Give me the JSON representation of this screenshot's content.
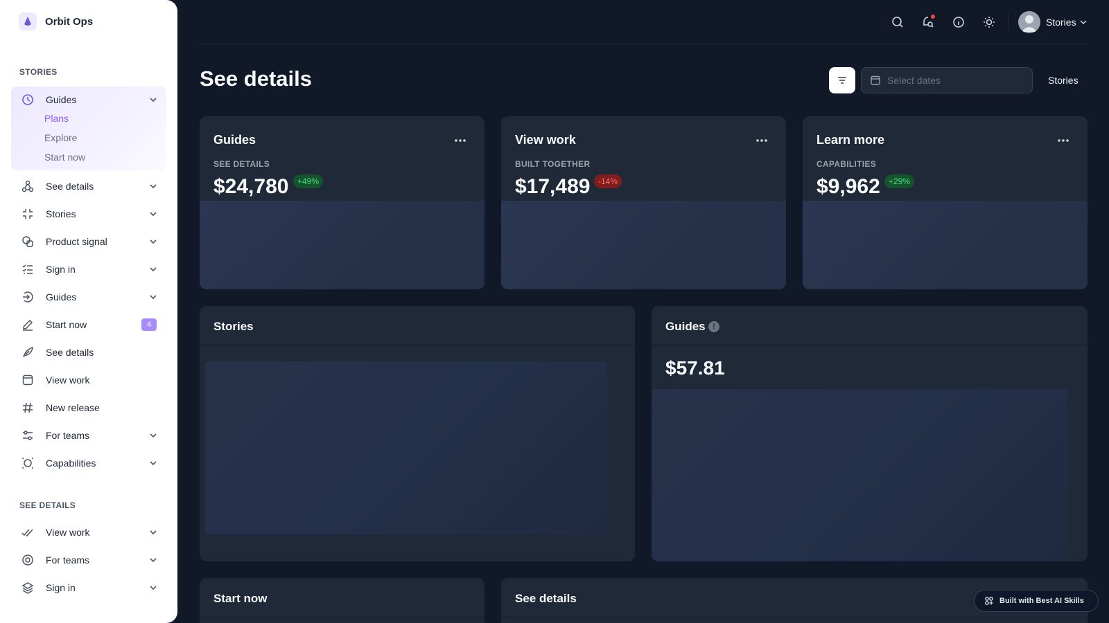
{
  "brand": {
    "name": "Orbit Ops",
    "icon": "drop-logo-icon"
  },
  "sidebar": {
    "section1_title": "STORIES",
    "section2_title": "SEE DETAILS",
    "open_group": {
      "label": "Guides",
      "icon": "clock-icon",
      "children": [
        "Plans",
        "Explore",
        "Start now"
      ],
      "active_child": "Plans"
    },
    "items": [
      {
        "label": "See details",
        "icon": "share-nodes-icon",
        "has_chevron": true
      },
      {
        "label": "Stories",
        "icon": "minimize-icon",
        "has_chevron": true
      },
      {
        "label": "Product signal",
        "icon": "shapes-icon",
        "has_chevron": true
      },
      {
        "label": "Sign in",
        "icon": "checklist-icon",
        "has_chevron": true
      },
      {
        "label": "Guides",
        "icon": "circle-arrow-icon",
        "has_chevron": true
      },
      {
        "label": "Start now",
        "icon": "pencil-icon",
        "badge": "4"
      },
      {
        "label": "See details",
        "icon": "feather-icon"
      },
      {
        "label": "View work",
        "icon": "square-icon"
      },
      {
        "label": "New release",
        "icon": "hash-icon"
      },
      {
        "label": "For teams",
        "icon": "sliders-icon",
        "has_chevron": true
      },
      {
        "label": "Capabilities",
        "icon": "focus-icon",
        "has_chevron": true
      }
    ],
    "items2": [
      {
        "label": "View work",
        "icon": "double-check-icon",
        "has_chevron": true
      },
      {
        "label": "For teams",
        "icon": "target-icon",
        "has_chevron": true
      },
      {
        "label": "Sign in",
        "icon": "layers-icon",
        "has_chevron": true
      }
    ]
  },
  "topbar": {
    "icons": [
      "search-icon",
      "notification-search-icon",
      "info-icon",
      "sun-icon"
    ],
    "user_name": "Stories"
  },
  "page": {
    "title": "See details",
    "date_placeholder": "Select dates",
    "header_link": "Stories"
  },
  "stat_cards": [
    {
      "title": "Guides",
      "subtitle": "SEE DETAILS",
      "value": "$24,780",
      "delta": "+49%",
      "trend": "up"
    },
    {
      "title": "View work",
      "subtitle": "BUILT TOGETHER",
      "value": "$17,489",
      "delta": "-14%",
      "trend": "down"
    },
    {
      "title": "Learn more",
      "subtitle": "CAPABILITIES",
      "value": "$9,962",
      "delta": "+29%",
      "trend": "up"
    }
  ],
  "panels": {
    "stories": {
      "title": "Stories"
    },
    "guides": {
      "title": "Guides",
      "value": "$57.81"
    },
    "start_now": {
      "title": "Start now"
    },
    "see_details": {
      "title": "See details"
    }
  },
  "footer_badge": "Built with Best AI Skills",
  "colors": {
    "accent": "#8b5cf6",
    "background": "#111827",
    "card": "#1f2937",
    "positive": "#4ade80",
    "negative": "#f87171"
  }
}
